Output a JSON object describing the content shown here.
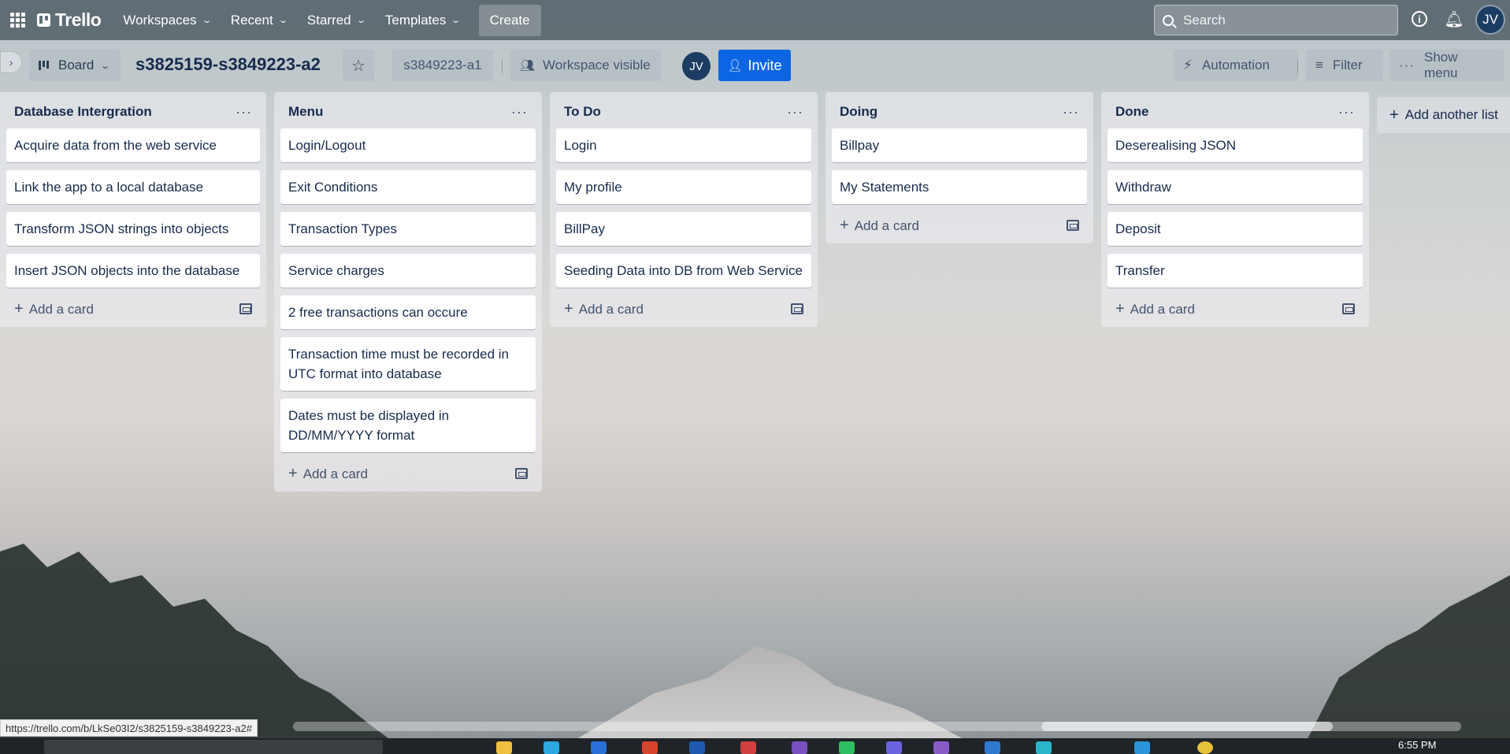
{
  "header": {
    "logo_text": "Trello",
    "nav": [
      "Workspaces",
      "Recent",
      "Starred",
      "Templates"
    ],
    "create_label": "Create",
    "search_placeholder": "Search",
    "user_initials": "JV"
  },
  "boardbar": {
    "view_label": "Board",
    "board_title": "s3825159-s3849223-a2",
    "workspace_label": "s3849223-a1",
    "visibility_label": "Workspace visible",
    "member_initials": "JV",
    "invite_label": "Invite",
    "automation_label": "Automation",
    "filter_label": "Filter",
    "show_menu_label": "Show menu"
  },
  "lists": [
    {
      "title": "Database Intergration",
      "cards": [
        "Acquire data from the web service",
        "Link the app to a local database",
        "Transform JSON strings into objects",
        "Insert JSON objects into the database"
      ],
      "add_card_label": "Add a card"
    },
    {
      "title": "Menu",
      "cards": [
        "Login/Logout",
        "Exit Conditions",
        "Transaction Types",
        "Service charges",
        "2 free transactions can occure",
        "Transaction time must be recorded in UTC format into database",
        "Dates must be displayed in DD/MM/YYYY format"
      ],
      "add_card_label": "Add a card"
    },
    {
      "title": "To Do",
      "cards": [
        "Login",
        "My profile",
        "BillPay",
        "Seeding Data into DB from Web Service"
      ],
      "add_card_label": "Add a card"
    },
    {
      "title": "Doing",
      "cards": [
        "Billpay",
        "My Statements"
      ],
      "add_card_label": "Add a card"
    },
    {
      "title": "Done",
      "cards": [
        "Deserealising JSON",
        "Withdraw",
        "Deposit",
        "Transfer"
      ],
      "add_card_label": "Add a card"
    }
  ],
  "add_list_label": "Add another list",
  "status_url": "https://trello.com/b/LkSe03I2/s3825159-s3849223-a2#",
  "taskbar_time": "6:55 PM",
  "icons": [
    "apps-grid-icon",
    "trello-logo-icon",
    "chevron-down-icon",
    "search-icon",
    "info-icon",
    "bell-icon",
    "board-view-icon",
    "star-icon",
    "eye-icon",
    "add-person-icon",
    "bolt-icon",
    "filter-icon",
    "ellipsis-icon",
    "plus-icon",
    "template-icon",
    "chevron-right-icon"
  ],
  "colors": {
    "header_bg": "#46545c",
    "invite_blue": "#0c66e4",
    "avatar_navy": "#1c3d63",
    "list_bg": "#ebecf0",
    "card_bg": "#ffffff",
    "text": "#172b4d"
  }
}
